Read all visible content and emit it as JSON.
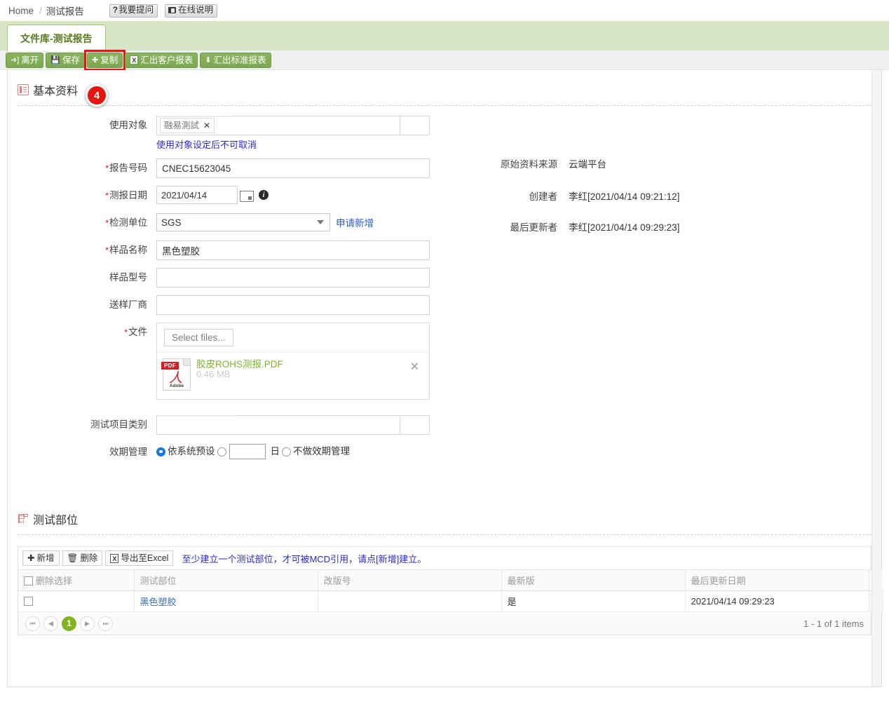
{
  "breadcrumb": {
    "home": "Home",
    "separator": "/",
    "current": "测试报告",
    "ask_button": "我要提问",
    "ask_icon": "question-mark",
    "help_button": "在线说明",
    "help_icon": "book-icon"
  },
  "tab": {
    "label": "文件库-测试报告"
  },
  "toolbar": {
    "leave": "离开",
    "leave_icon": "exit-icon",
    "save": "保存",
    "save_icon": "floppy-disk-icon",
    "copy": "复制",
    "copy_icon": "plus-icon",
    "export_customer": "汇出客户报表",
    "export_customer_icon": "excel-icon",
    "export_standard": "汇出标准报表",
    "export_standard_icon": "download-icon"
  },
  "step_badge": {
    "copy": "4"
  },
  "basic_section": {
    "title": "基本资料",
    "icon": "list-icon"
  },
  "form": {
    "usage_target": {
      "label": "使用对象",
      "token": "融易測試",
      "token_remove": "✕",
      "hint": "使用对象设定后不可取消"
    },
    "report_no": {
      "label": "报告号码",
      "required": true,
      "value": "CNEC15623045"
    },
    "report_date": {
      "label": "测报日期",
      "required": true,
      "value": "2021/04/14",
      "calendar_icon": "calendar-icon",
      "info_icon": "info-icon"
    },
    "test_unit": {
      "label": "检测单位",
      "required": true,
      "value": "SGS",
      "apply_link": "申请新增"
    },
    "sample_name": {
      "label": "样品名称",
      "required": true,
      "value": "黑色塑胶"
    },
    "sample_model": {
      "label": "样品型号",
      "required": false,
      "value": ""
    },
    "sample_vendor": {
      "label": "送样厂商",
      "required": false,
      "value": ""
    },
    "file": {
      "label": "文件",
      "required": true,
      "select_button": "Select files...",
      "attachment_name": "胶皮ROHS测报.PDF",
      "attachment_size": "0.46 MB",
      "attachment_type": "PDF",
      "attachment_brand": "Adobe",
      "remove_icon": "✕"
    },
    "test_category": {
      "label": "测试项目类别",
      "value": ""
    },
    "validity": {
      "label": "效期管理",
      "option_system": "依系统预设",
      "option_days_value": "",
      "option_days_unit": "日",
      "option_none": "不做效期管理",
      "selected": "system"
    }
  },
  "info": {
    "source_label": "原始资料来源",
    "source_value": "云端平台",
    "creator_label": "创建者",
    "creator_value": "李红[2021/04/14 09:21:12]",
    "updater_label": "最后更新者",
    "updater_value": "李红[2021/04/14 09:29:23]"
  },
  "parts_section": {
    "title": "测试部位",
    "icon": "tree-icon",
    "toolbar": {
      "add": "新增",
      "add_icon": "plus-icon",
      "delete": "删除",
      "delete_icon": "trash-icon",
      "export_excel": "导出至Excel",
      "export_icon": "excel-icon",
      "note": "至少建立一个测试部位，才可被MCD引用，请点[新增]建立。"
    },
    "columns": [
      "删除选择",
      "测试部位",
      "改版号",
      "最新版",
      "最后更新日期"
    ],
    "rows": [
      {
        "checked": false,
        "part": "黑色塑胶",
        "revision": "",
        "latest": "是",
        "updated": "2021/04/14 09:29:23"
      }
    ],
    "pager": {
      "first_icon": "first-page-icon",
      "prev_icon": "prev-page-icon",
      "current_page": "1",
      "next_icon": "next-page-icon",
      "last_icon": "last-page-icon",
      "info": "1 - 1 of 1 items"
    }
  },
  "colors": {
    "tab_strip": "#d7e5c5",
    "toolbar_button": "#7aa84f",
    "accent_link": "#2a2ad0",
    "highlight": "#e8140f",
    "pager_active": "#80b520",
    "file_name": "#7db52a"
  }
}
